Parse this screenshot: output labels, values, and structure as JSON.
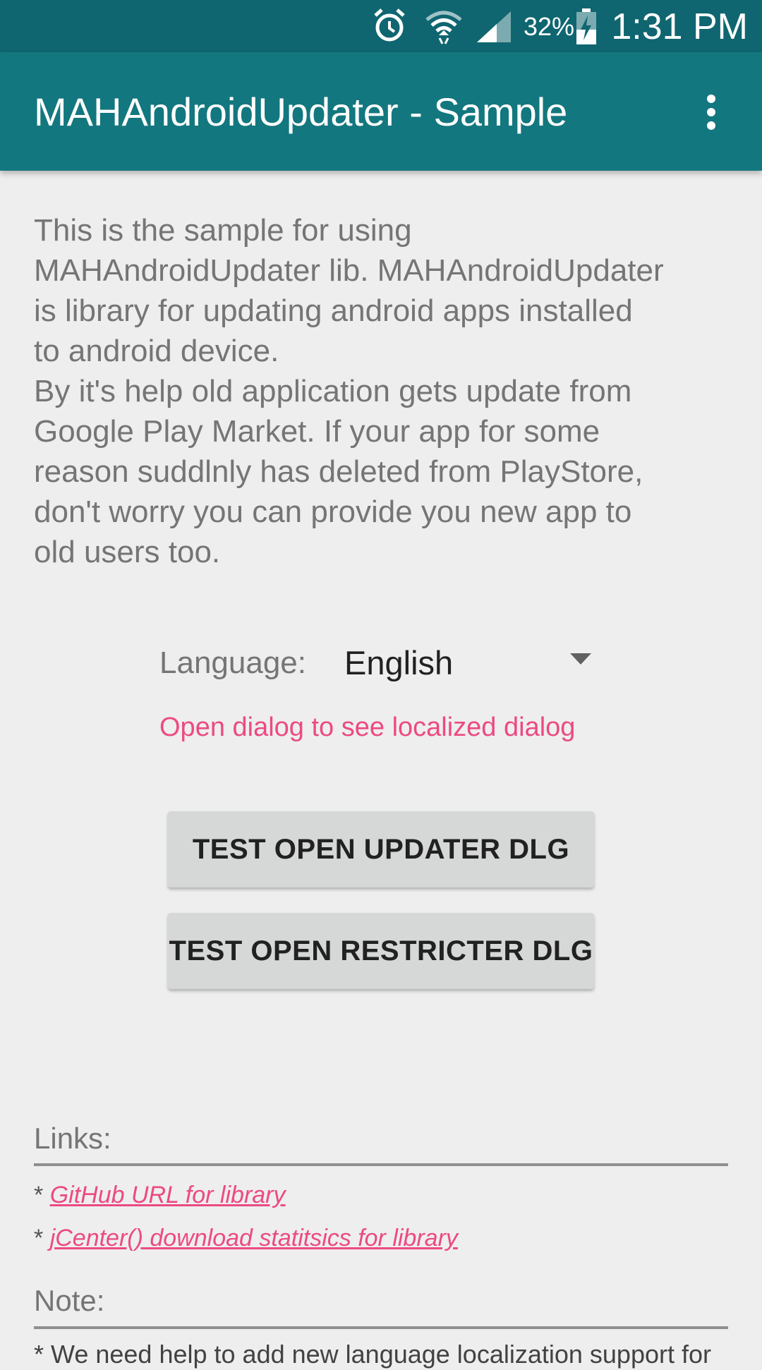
{
  "status_bar": {
    "battery_percent": "32%",
    "time": "1:31 PM",
    "icons": [
      "alarm-icon",
      "wifi-icon",
      "cell-signal-icon",
      "battery-charging-icon"
    ]
  },
  "app_bar": {
    "title": "MAHAndroidUpdater - Sample",
    "overflow_icon": "more-vert-icon"
  },
  "intro": {
    "lines": [
      "This is the sample for using",
      "MAHAndroidUpdater lib. MAHAndroidUpdater",
      "is library for updating android apps installed",
      "to android device.",
      "By it's help old application gets update from",
      "Google Play Market. If your app for some",
      "reason suddlnly has deleted from PlayStore,",
      "don't worry you can provide you new app to",
      "old users too."
    ]
  },
  "language": {
    "label": "Language:",
    "selected": "English",
    "hint": "Open dialog to see localized dialog"
  },
  "buttons": {
    "updater": "TEST OPEN UPDATER DLG",
    "restricter": "TEST OPEN RESTRICTER DLG"
  },
  "links": {
    "heading": "Links:",
    "bullet": "*",
    "github": "GitHub URL for library",
    "jcenter": "jCenter() download statitsics for library"
  },
  "note": {
    "heading": "Note:",
    "text": "* We need help to add new language localization support for"
  },
  "colors": {
    "status_bar": "#0f6670",
    "app_bar": "#13777f",
    "accent": "#ec4a83",
    "background": "#eeeeee"
  }
}
